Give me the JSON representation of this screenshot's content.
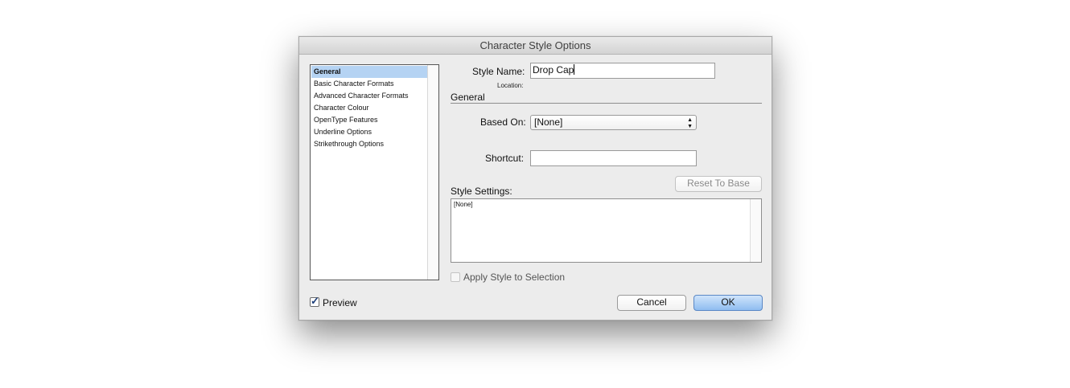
{
  "window": {
    "title": "Character Style Options"
  },
  "categories": [
    {
      "label": "General",
      "selected": true
    },
    {
      "label": "Basic Character Formats",
      "selected": false
    },
    {
      "label": "Advanced Character Formats",
      "selected": false
    },
    {
      "label": "Character Colour",
      "selected": false
    },
    {
      "label": "OpenType Features",
      "selected": false
    },
    {
      "label": "Underline Options",
      "selected": false
    },
    {
      "label": "Strikethrough Options",
      "selected": false
    }
  ],
  "form": {
    "style_name_label": "Style Name:",
    "style_name_value": "Drop Cap",
    "location_label": "Location:",
    "section_title": "General",
    "based_on_label": "Based On:",
    "based_on_value": "[None]",
    "shortcut_label": "Shortcut:",
    "shortcut_value": "",
    "reset_button": "Reset To Base",
    "style_settings_label": "Style Settings:",
    "style_settings_value": "[None]",
    "apply_label": "Apply Style to Selection",
    "apply_checked": false
  },
  "footer": {
    "preview_label": "Preview",
    "preview_checked": true,
    "cancel": "Cancel",
    "ok": "OK"
  }
}
